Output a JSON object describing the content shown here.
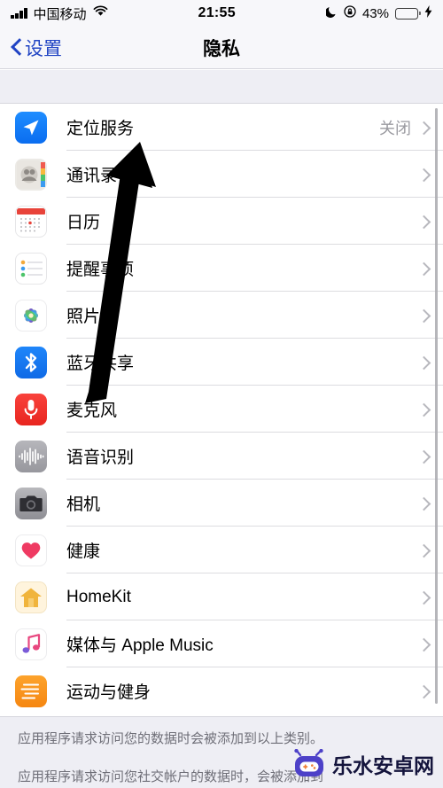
{
  "status_bar": {
    "carrier": "中国移动",
    "wifi_icon": "wifi-icon",
    "signal_icon": "signal-bars-icon",
    "time": "21:55",
    "dnd_icon": "moon-icon",
    "rotation_lock_icon": "rotation-lock-icon",
    "battery_percent": "43%",
    "battery_level": 43,
    "charging_icon": "lightning-bolt-icon",
    "battery_color": "#4cd662"
  },
  "nav": {
    "back_label": "设置",
    "back_icon": "chevron-left-icon",
    "title": "隐私",
    "accent_color": "#2144c4"
  },
  "list": {
    "rows": [
      {
        "label": "定位服务",
        "value": "关闭",
        "icon": "location-arrow-icon",
        "icon_class": "ic-location"
      },
      {
        "label": "通讯录",
        "value": "",
        "icon": "contacts-icon",
        "icon_class": "ic-contacts"
      },
      {
        "label": "日历",
        "value": "",
        "icon": "calendar-icon",
        "icon_class": "ic-calendar"
      },
      {
        "label": "提醒事项",
        "value": "",
        "icon": "reminders-icon",
        "icon_class": "ic-reminders"
      },
      {
        "label": "照片",
        "value": "",
        "icon": "photos-icon",
        "icon_class": "ic-photos"
      },
      {
        "label": "蓝牙共享",
        "value": "",
        "icon": "bluetooth-icon",
        "icon_class": "ic-bluetooth"
      },
      {
        "label": "麦克风",
        "value": "",
        "icon": "microphone-icon",
        "icon_class": "ic-mic"
      },
      {
        "label": "语音识别",
        "value": "",
        "icon": "speech-waveform-icon",
        "icon_class": "ic-speech"
      },
      {
        "label": "相机",
        "value": "",
        "icon": "camera-icon",
        "icon_class": "ic-camera"
      },
      {
        "label": "健康",
        "value": "",
        "icon": "heart-icon",
        "icon_class": "ic-health"
      },
      {
        "label": "HomeKit",
        "value": "",
        "icon": "house-icon",
        "icon_class": "ic-homekit"
      },
      {
        "label": "媒体与 Apple Music",
        "value": "",
        "icon": "music-note-icon",
        "icon_class": "ic-music"
      },
      {
        "label": "运动与健身",
        "value": "",
        "icon": "motion-fitness-icon",
        "icon_class": "ic-fitness"
      }
    ],
    "disclosure_icon": "chevron-right-icon"
  },
  "footer": {
    "line1": "应用程序请求访问您的数据时会被添加到以上类别。",
    "line2": "应用程序请求访问您社交帐户的数据时，会被添加到"
  },
  "annotation": {
    "arrow_icon": "up-arrow-annotation",
    "arrow_color": "#000000"
  },
  "watermark": {
    "text": "乐水安卓网",
    "logo_icon": "robot-logo-icon",
    "logo_color": "#4d41c8"
  },
  "scrollbar": {
    "icon": "vertical-scrollbar"
  }
}
